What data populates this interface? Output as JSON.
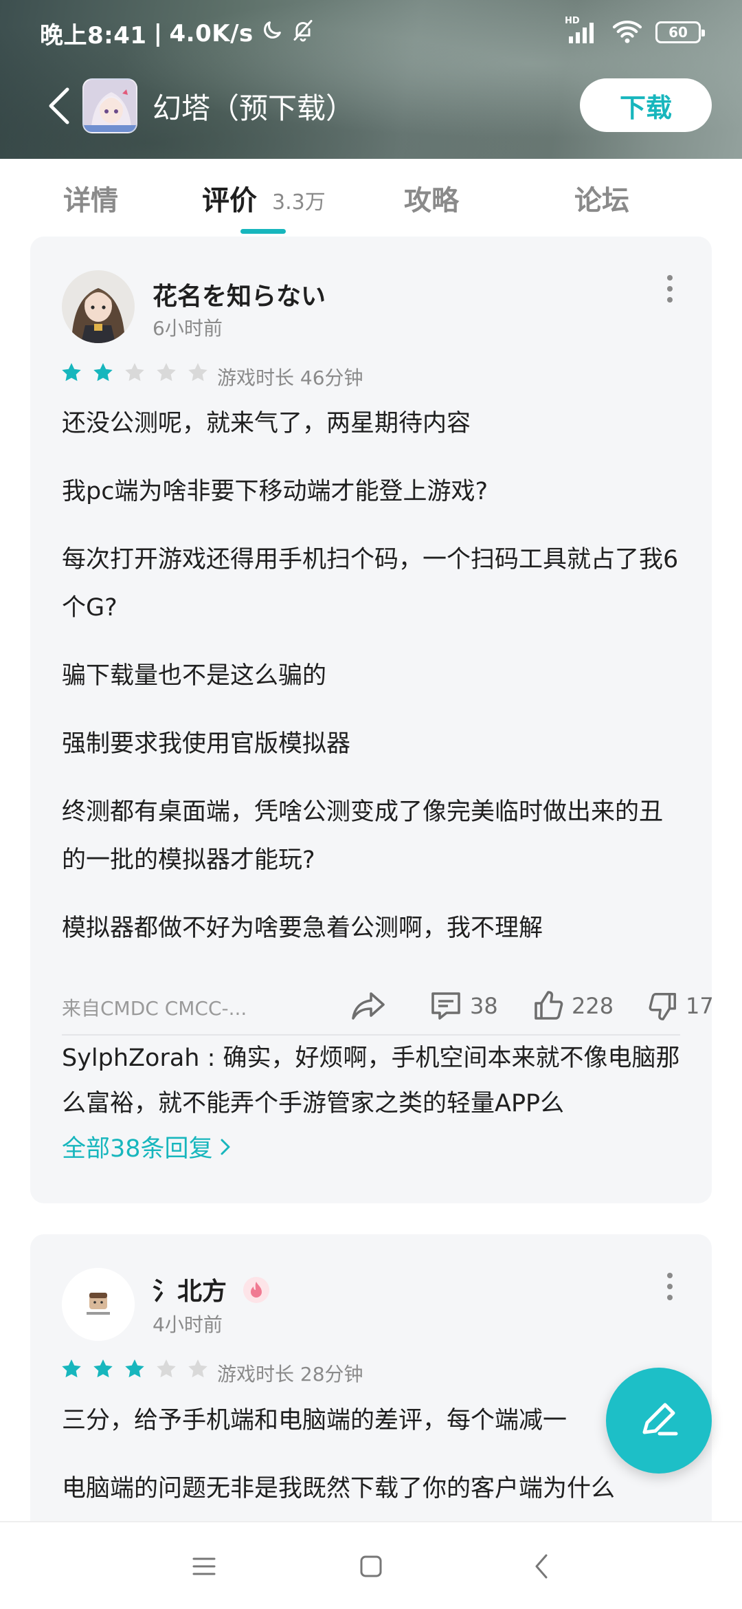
{
  "status_bar": {
    "time": "晚上8:41",
    "speed": "4.0K/s",
    "network": "HD",
    "battery": "60"
  },
  "header": {
    "title": "幻塔（预下载）",
    "download_label": "下载"
  },
  "tabs": [
    {
      "label": "详情",
      "active": false
    },
    {
      "label": "评价",
      "active": true,
      "count": "3.3万"
    },
    {
      "label": "攻略",
      "active": false
    },
    {
      "label": "论坛",
      "active": false
    }
  ],
  "reviews": [
    {
      "user": "花名を知らない",
      "time": "6小时前",
      "rating": 2,
      "max_rating": 5,
      "play_time": "游戏时长 46分钟",
      "paragraphs": [
        "还没公测呢，就来气了，两星期待内容",
        "我pc端为啥非要下移动端才能登上游戏?",
        "每次打开游戏还得用手机扫个码，一个扫码工具就占了我6个G?",
        "骗下载量也不是这么骗的",
        "强制要求我使用官版模拟器",
        "终测都有桌面端，凭啥公测变成了像完美临时做出来的丑的一批的模拟器才能玩?",
        "模拟器都做不好为啥要急着公测啊，我不理解"
      ],
      "device": "来自CMDC CMCC-...",
      "comments": "38",
      "likes": "228",
      "dislikes": "17",
      "reply_preview": "SylphZorah : 确实，好烦啊，手机空间本来就不像电脑那么富裕，就不能弄个手游管家之类的轻量APP么",
      "all_replies": "全部38条回复"
    },
    {
      "user": "氵北方",
      "time": "4小时前",
      "rating": 3,
      "max_rating": 5,
      "play_time": "游戏时长 28分钟",
      "paragraphs": [
        "三分，给予手机端和电脑端的差评，每个端减一",
        "电脑端的问题无非是我既然下载了你的客户端为什么"
      ]
    }
  ],
  "colors": {
    "accent": "#17b6bd",
    "star_filled": "#17b6bd",
    "star_empty": "#d9d9d9",
    "card_bg": "#f5f6f8"
  },
  "icons": {
    "back": "chevron-left-icon",
    "share": "share-icon",
    "comment": "comment-icon",
    "like": "thumbs-up-icon",
    "dislike": "thumbs-down-icon",
    "more": "more-vertical-icon",
    "fab": "write-icon"
  }
}
